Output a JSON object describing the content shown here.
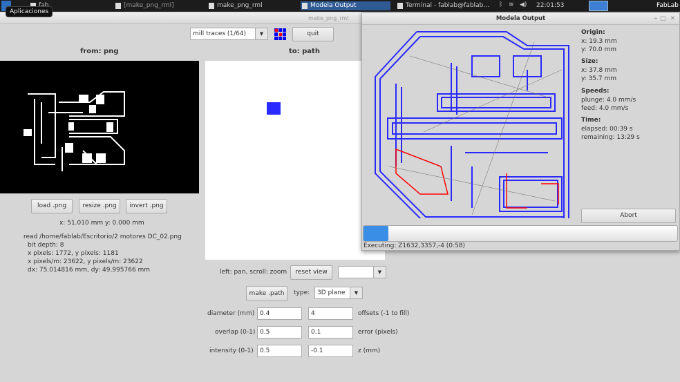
{
  "taskbar": {
    "apps_tooltip": "Aplicaciones",
    "items": [
      "fab",
      "[make_png_rml]",
      "make_png_rml",
      "Modela Output",
      "Terminal - fablab@fablab..."
    ],
    "clock": "22:01:53",
    "user": "FabLab"
  },
  "main": {
    "title": "make_png_rml",
    "mode": "mill traces (1/64)",
    "quit": "quit",
    "from": "from: png",
    "to": "to: path",
    "buttons": {
      "load": "load .png",
      "resize": "resize .png",
      "invert": "invert .png",
      "reset": "reset view",
      "make": "make .path"
    },
    "coords": "x: 51.010 mm  y: 0.000 mm",
    "info": [
      "read /home/fablab/Escritorio/2 motores DC_02.png",
      "bit depth: 8",
      "x pixels: 1772, y pixels: 1181",
      "x pixels/m: 23622, y pixels/m: 23622",
      "dx: 75.014816 mm, dy: 49.995766 mm"
    ],
    "hint": "left: pan, scroll: zoom",
    "type_label": "type:",
    "type_value": "3D plane",
    "params": [
      {
        "label": "diameter (mm)",
        "v1": "0.4",
        "v2": "4",
        "label2": "offsets (-1 to fill)"
      },
      {
        "label": "overlap (0-1)",
        "v1": "0.5",
        "v2": "0.1",
        "label2": "error (pixels)"
      },
      {
        "label": "intensity (0-1)",
        "v1": "0.5",
        "v2": "-0.1",
        "label2": "z (mm)"
      }
    ]
  },
  "modela": {
    "title": "Modela Output",
    "origin": {
      "h": "Origin:",
      "x": "x: 19.3 mm",
      "y": "y: 70.0 mm"
    },
    "size": {
      "h": "Size:",
      "x": "x: 37.8 mm",
      "y": "y: 35.7 mm"
    },
    "speeds": {
      "h": "Speeds:",
      "plunge": "plunge: 4.0 mm/s",
      "feed": "feed: 4.0 mm/s"
    },
    "time": {
      "h": "Time:",
      "elapsed": "elapsed: 00:39 s",
      "remaining": "remaining: 13:29 s"
    },
    "abort": "Abort",
    "progress_percent": 8,
    "status": "Executing: Z1632,3357,-4 (0:58)"
  },
  "colors": {
    "path": "#2a2aff",
    "done": "#ff0000",
    "progress": "#3a8ee6"
  }
}
